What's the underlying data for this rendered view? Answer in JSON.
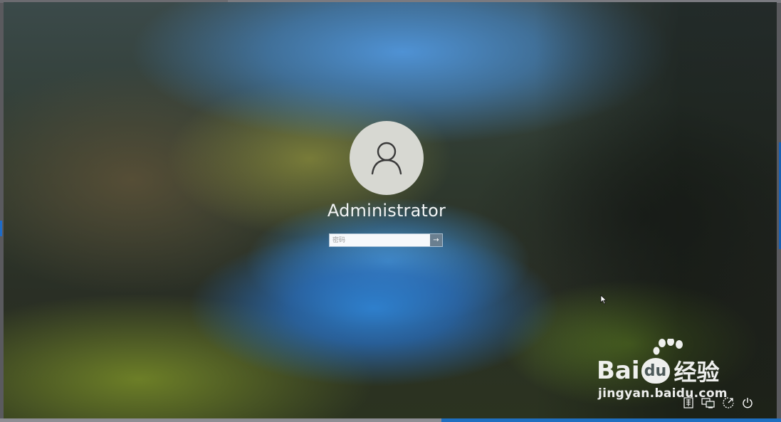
{
  "lock_screen": {
    "username": "Administrator",
    "password_placeholder": "密码",
    "submit_glyph": "→"
  },
  "watermark": {
    "brand_left": "Bai",
    "brand_right": "经验",
    "url": "jingyan.baidu.com"
  },
  "bottom_icons": [
    "ime-icon",
    "network-icon",
    "accessibility-icon",
    "power-icon"
  ],
  "colors": {
    "avatar_bg": "#d7d8d2",
    "submit_bg": "#6a7f90",
    "text": "#f2f4f4"
  }
}
